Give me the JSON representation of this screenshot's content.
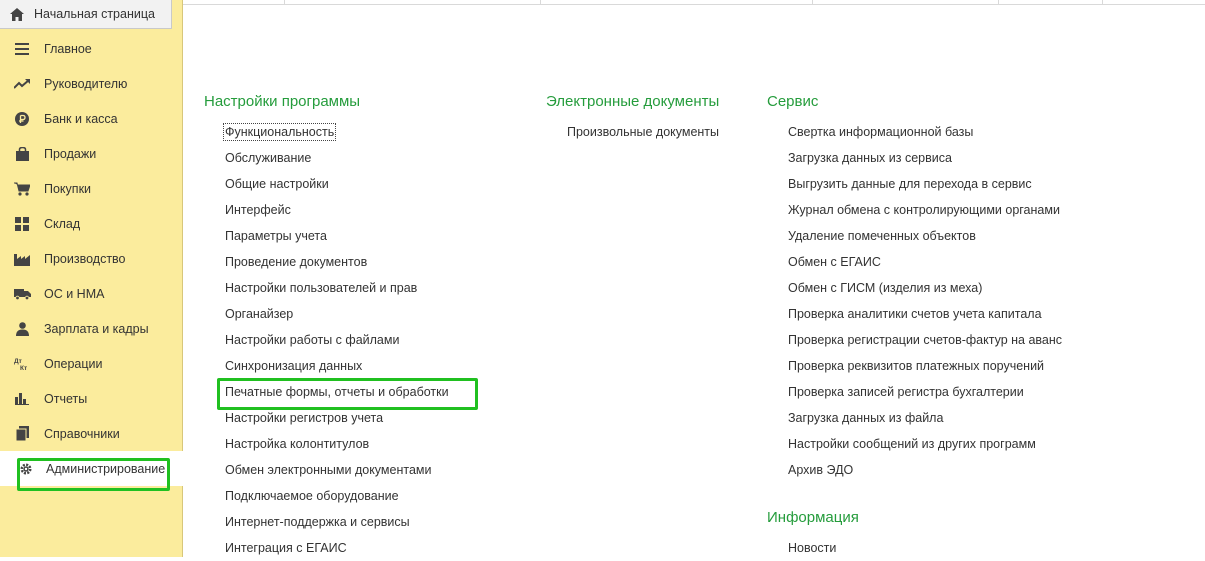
{
  "home_tab": {
    "label": "Начальная страница",
    "icon": "home-icon"
  },
  "sidebar": {
    "items": [
      {
        "label": "Главное",
        "icon": "menu-icon"
      },
      {
        "label": "Руководителю",
        "icon": "trend-icon"
      },
      {
        "label": "Банк и касса",
        "icon": "ruble-icon"
      },
      {
        "label": "Продажи",
        "icon": "bag-icon"
      },
      {
        "label": "Покупки",
        "icon": "cart-icon"
      },
      {
        "label": "Склад",
        "icon": "grid-icon"
      },
      {
        "label": "Производство",
        "icon": "factory-icon"
      },
      {
        "label": "ОС и НМА",
        "icon": "truck-icon"
      },
      {
        "label": "Зарплата и кадры",
        "icon": "person-icon"
      },
      {
        "label": "Операции",
        "icon": "dt-kt-icon"
      },
      {
        "label": "Отчеты",
        "icon": "bar-chart-icon"
      },
      {
        "label": "Справочники",
        "icon": "books-icon"
      },
      {
        "label": "Администрирование",
        "icon": "gear-icon",
        "active": true
      }
    ]
  },
  "settings": {
    "title": "Настройки программы",
    "links": [
      "Функциональность",
      "Обслуживание",
      "Общие настройки",
      "Интерфейс",
      "Параметры учета",
      "Проведение документов",
      "Настройки пользователей и прав",
      "Органайзер",
      "Настройки работы с файлами",
      "Синхронизация данных",
      "Печатные формы, отчеты и обработки",
      "Настройки регистров учета",
      "Настройка колонтитулов",
      "Обмен электронными документами",
      "Подключаемое оборудование",
      "Интернет-поддержка и сервисы",
      "Интеграция с ЕГАИС"
    ]
  },
  "edocs": {
    "title": "Электронные документы",
    "links": [
      "Произвольные документы"
    ]
  },
  "service": {
    "title": "Сервис",
    "links": [
      "Свертка информационной базы",
      "Загрузка данных из сервиса",
      "Выгрузить данные для перехода в сервис",
      "Журнал обмена с контролирующими органами",
      "Удаление помеченных объектов",
      "Обмен с ЕГАИС",
      "Обмен с ГИСМ (изделия из меха)",
      "Проверка аналитики счетов учета капитала",
      "Проверка регистрации счетов-фактур на аванс",
      "Проверка реквизитов платежных поручений",
      "Проверка записей регистра бухгалтерии",
      "Загрузка данных из файла",
      "Настройки сообщений из других программ",
      "Архив ЭДО"
    ]
  },
  "info": {
    "title": "Информация",
    "links": [
      "Новости"
    ]
  },
  "colors": {
    "sidebar_bg": "#fbec9d",
    "group_title": "#259c3c",
    "highlight": "#20c020"
  }
}
